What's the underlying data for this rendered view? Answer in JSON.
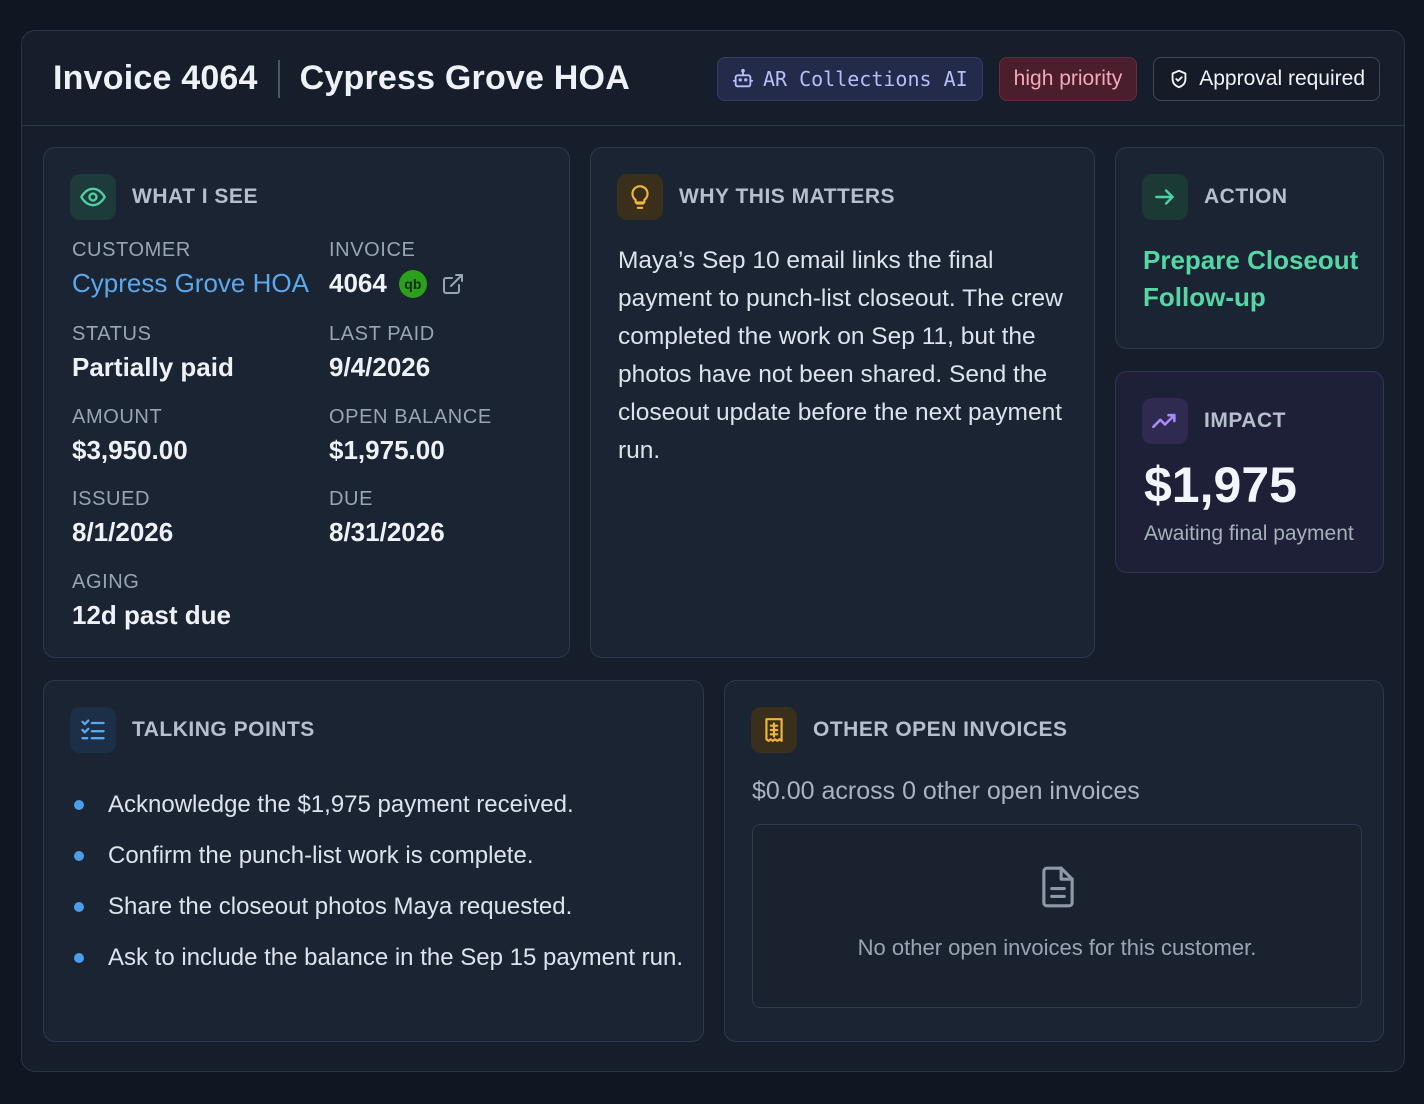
{
  "header": {
    "invoice_title": "Invoice 4064",
    "customer_title": "Cypress Grove HOA",
    "badges": {
      "agent": "AR Collections AI",
      "priority": "high priority",
      "approval": "Approval required"
    }
  },
  "what_i_see": {
    "title": "WHAT I SEE",
    "fields": {
      "customer": {
        "label": "CUSTOMER",
        "value": "Cypress Grove HOA"
      },
      "invoice": {
        "label": "INVOICE",
        "value": "4064",
        "qb_icon": "qb"
      },
      "status": {
        "label": "STATUS",
        "value": "Partially paid"
      },
      "last_paid": {
        "label": "LAST PAID",
        "value": "9/4/2026"
      },
      "amount": {
        "label": "AMOUNT",
        "value": "$3,950.00"
      },
      "open_balance": {
        "label": "OPEN BALANCE",
        "value": "$1,975.00"
      },
      "issued": {
        "label": "ISSUED",
        "value": "8/1/2026"
      },
      "due": {
        "label": "DUE",
        "value": "8/31/2026"
      },
      "aging": {
        "label": "AGING",
        "value": "12d past due"
      }
    }
  },
  "why": {
    "title": "WHY THIS MATTERS",
    "text": "Maya’s Sep 10 email links the final payment to punch-list closeout. The crew completed the work on Sep 11, but the photos have not been shared. Send the closeout update before the next payment run."
  },
  "action": {
    "title": "ACTION",
    "text": "Prepare Closeout Follow-up"
  },
  "impact": {
    "title": "IMPACT",
    "value": "$1,975",
    "subtitle": "Awaiting final payment"
  },
  "talking_points": {
    "title": "TALKING POINTS",
    "items": [
      "Acknowledge the $1,975 payment received.",
      "Confirm the punch-list work is complete.",
      "Share the closeout photos Maya requested.",
      "Ask to include the balance in the Sep 15 payment run."
    ]
  },
  "other_invoices": {
    "title": "OTHER OPEN INVOICES",
    "summary": "$0.00 across 0 other open invoices",
    "empty_message": "No other open invoices for this customer."
  },
  "colors": {
    "accent_blue": "#5aa8ee",
    "accent_green": "#56d6a4",
    "priority": "#f3a9b8",
    "quickbooks": "#2ca01c"
  }
}
